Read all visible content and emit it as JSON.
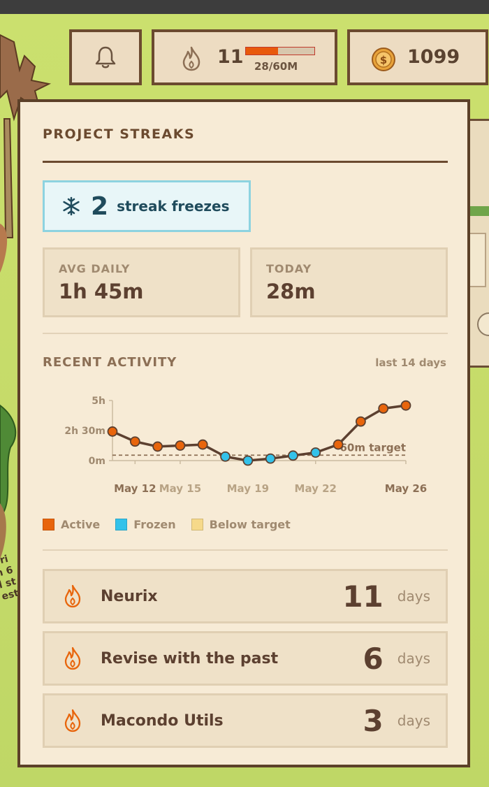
{
  "hud": {
    "streak_count": "11",
    "progress_text": "28/60M",
    "progress_fraction": 0.47,
    "coins": "1099"
  },
  "panel": {
    "title": "PROJECT STREAKS",
    "freeze_count": "2",
    "freeze_label": "streak freezes",
    "avg_label": "AVG DAILY",
    "avg_value": "1h 45m",
    "today_label": "TODAY",
    "today_value": "28m",
    "activity_title": "RECENT ACTIVITY",
    "activity_range": "last 14 days"
  },
  "side_text": [
    "uri",
    "h 6",
    "l st",
    "est"
  ],
  "chart_data": {
    "type": "line",
    "yticks": [
      "5h",
      "2h 30m",
      "0m"
    ],
    "ylim_minutes": [
      0,
      300
    ],
    "x_labels": [
      "May 12",
      "May 15",
      "May 19",
      "May 22",
      "May 26"
    ],
    "target_label": "60m target",
    "target_minutes": 60,
    "points_minutes": [
      145,
      95,
      70,
      75,
      80,
      20,
      0,
      10,
      25,
      40,
      80,
      195,
      260,
      275
    ],
    "point_status": [
      "active",
      "active",
      "active",
      "active",
      "active",
      "frozen",
      "frozen",
      "frozen",
      "frozen",
      "frozen",
      "active",
      "active",
      "active",
      "active"
    ],
    "colors": {
      "active": "#e8650c",
      "frozen": "#33c2ea",
      "below": "#f6d98a",
      "line": "#5c4030"
    }
  },
  "legend": [
    {
      "label": "Active",
      "color": "#e8650c"
    },
    {
      "label": "Frozen",
      "color": "#33c2ea"
    },
    {
      "label": "Below target",
      "color": "#f6d98a"
    }
  ],
  "projects": [
    {
      "name": "Neurix",
      "days": "11",
      "unit": "days"
    },
    {
      "name": "Revise with the past",
      "days": "6",
      "unit": "days"
    },
    {
      "name": "Macondo Utils",
      "days": "3",
      "unit": "days"
    }
  ]
}
